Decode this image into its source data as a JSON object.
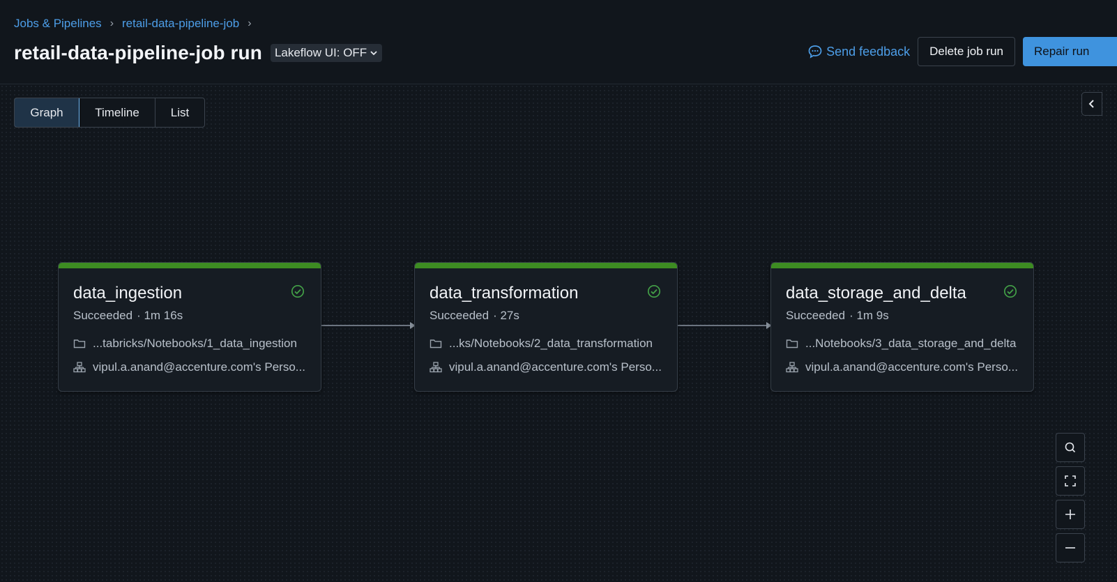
{
  "breadcrumb": [
    "Jobs & Pipelines",
    "retail-data-pipeline-job"
  ],
  "page_title": "retail-data-pipeline-job run",
  "lakeflow_toggle": "Lakeflow UI: OFF",
  "actions": {
    "feedback": "Send feedback",
    "delete": "Delete job run",
    "repair": "Repair run"
  },
  "view_tabs": [
    "Graph",
    "Timeline",
    "List"
  ],
  "active_tab": "Graph",
  "tasks": [
    {
      "name": "data_ingestion",
      "status": "Succeeded",
      "duration": "· 1m 16s",
      "path": "...tabricks/Notebooks/1_data_ingestion",
      "owner": "vipul.a.anand@accenture.com's Perso..."
    },
    {
      "name": "data_transformation",
      "status": "Succeeded",
      "duration": "· 27s",
      "path": "...ks/Notebooks/2_data_transformation",
      "owner": "vipul.a.anand@accenture.com's Perso..."
    },
    {
      "name": "data_storage_and_delta",
      "status": "Succeeded",
      "duration": "· 1m 9s",
      "path": "...Notebooks/3_data_storage_and_delta",
      "owner": "vipul.a.anand@accenture.com's Perso..."
    }
  ],
  "colors": {
    "success": "#3d8c22",
    "accent": "#3f93de",
    "link": "#4d9ee8"
  },
  "icons": [
    "chevron-right-icon",
    "chevron-down-icon",
    "feedback-icon",
    "collapse-panel-icon",
    "check-circle-icon",
    "folder-icon",
    "cluster-icon",
    "search-icon",
    "fit-view-icon",
    "zoom-in-icon",
    "zoom-out-icon"
  ]
}
